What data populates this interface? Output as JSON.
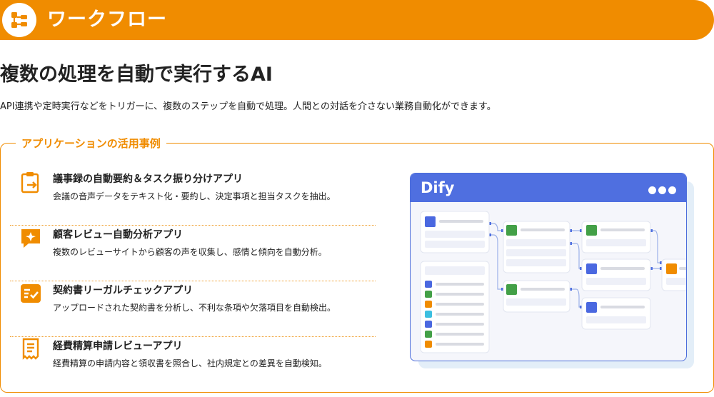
{
  "banner": {
    "title": "ワークフロー",
    "icon": "workflow-icon"
  },
  "headline": "複数の処理を自動で実行するAI",
  "lead": "API連携や定時実行などをトリガーに、複数のステップを自動で処理。人間との対話を介さない業務自動化ができます。",
  "section_label": "アプリケーションの活用事例",
  "accent_color": "#f08c00",
  "cases": [
    {
      "icon": "clipboard-icon",
      "title": "議事録の自動要約＆タスク振り分けアプリ",
      "desc": "会議の音声データをテキスト化・要約し、決定事項と担当タスクを抽出。"
    },
    {
      "icon": "chat-sparkle-icon",
      "title": "顧客レビュー自動分析アプリ",
      "desc": "複数のレビューサイトから顧客の声を収集し、感情と傾向を自動分析。"
    },
    {
      "icon": "checklist-icon",
      "title": "契約書リーガルチェックアプリ",
      "desc": "アップロードされた契約書を分析し、不利な条項や欠落項目を自動検出。"
    },
    {
      "icon": "receipt-icon",
      "title": "経費精算申請レビューアプリ",
      "desc": "経費精算の申請内容と領収書を照合し、社内規定との差異を自動検知。"
    }
  ],
  "mockup": {
    "brand": "Dify",
    "accent_color": "#4f6fe0"
  }
}
